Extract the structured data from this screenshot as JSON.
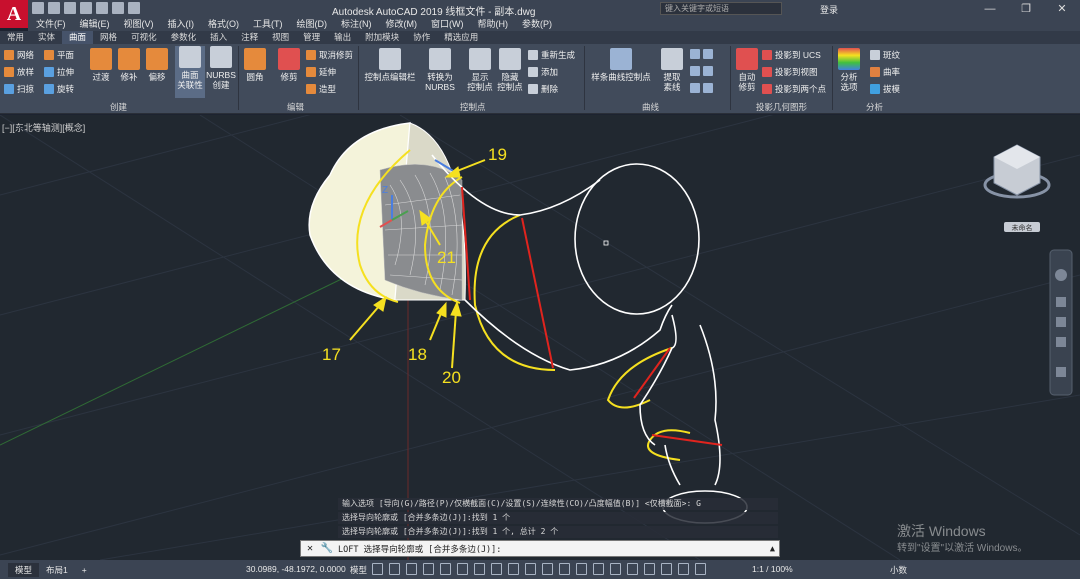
{
  "titlebar": {
    "logo": "A",
    "title": "Autodesk AutoCAD 2019    线框文件 - 副本.dwg",
    "search_placeholder": "键入关键字或短语",
    "login": "登录",
    "minimize": "—",
    "restore": "❐",
    "close": "✕"
  },
  "menu": [
    "文件(F)",
    "编辑(E)",
    "视图(V)",
    "插入(I)",
    "格式(O)",
    "工具(T)",
    "绘图(D)",
    "标注(N)",
    "修改(M)",
    "窗口(W)",
    "帮助(H)",
    "参数(P)"
  ],
  "ribbon_tabs": [
    {
      "label": "常用",
      "active": false
    },
    {
      "label": "实体",
      "active": false
    },
    {
      "label": "曲面",
      "active": true
    },
    {
      "label": "网格",
      "active": false
    },
    {
      "label": "可视化",
      "active": false
    },
    {
      "label": "参数化",
      "active": false
    },
    {
      "label": "插入",
      "active": false
    },
    {
      "label": "注释",
      "active": false
    },
    {
      "label": "视图",
      "active": false
    },
    {
      "label": "管理",
      "active": false
    },
    {
      "label": "输出",
      "active": false
    },
    {
      "label": "附加模块",
      "active": false
    },
    {
      "label": "协作",
      "active": false
    },
    {
      "label": "精选应用",
      "active": false
    }
  ],
  "ribbon": {
    "create_small": [
      "网络",
      "平面",
      "放样",
      "拉伸",
      "扫掠",
      "旋转"
    ],
    "create_big": [
      "过渡",
      "修补",
      "偏移"
    ],
    "associativity": "曲面\n关联性",
    "nurbs_create": "NURBS\n创建",
    "create_label": "创建",
    "fillet": "圆角",
    "trim": "修剪",
    "edit_small": [
      "取消修剪",
      "延伸",
      "造型"
    ],
    "edit_label": "编辑",
    "cv_editbar": "控制点编辑栏",
    "convert_nurbs": "转换为\nNURBS",
    "show_cv": "显示\n控制点",
    "hide_cv": "隐藏\n控制点",
    "cv_small": [
      "重新生成",
      "添加",
      "删除"
    ],
    "cv_label": "控制点",
    "spline_cv": "样条曲线控制点",
    "extract_isoline": "提取\n素线",
    "curve_label": "曲线",
    "auto_trim": "自动\n修剪",
    "proj_small": [
      "投影到 UCS",
      "投影到视图",
      "投影到两个点"
    ],
    "proj_label": "投影几何图形",
    "analysis_options": "分析\n选项",
    "analysis_small": [
      "斑纹",
      "曲率",
      "拔模"
    ],
    "analysis_label": "分析"
  },
  "viewport": {
    "label": "[−][东北等轴测][概念]",
    "viewcube_label": "未命名"
  },
  "annotations": [
    "19",
    "21",
    "17",
    "18",
    "20"
  ],
  "command_history": [
    "输入选项 [导向(G)/路径(P)/仅横截面(C)/设置(S)/连续性(CO)/凸度幅值(B)] <仅横截面>: G",
    "选择导向轮廓或 [合并多条边(J)]:找到 1 个",
    "选择导向轮廓或 [合并多条边(J)]:找到 1 个, 总计 2 个"
  ],
  "command_line": {
    "close": "✕",
    "tool": "🔧",
    "command": "LOFT 选择导向轮廓或 [合并多条边(J)]:",
    "expand": "▲"
  },
  "status": {
    "tab_model": "模型",
    "tab_layout": "布局1",
    "add": "+",
    "coords": "30.0989, -48.1972, 0.0000",
    "model": "模型",
    "scale": "1:1 / 100%",
    "units": "小数"
  },
  "watermark": {
    "line1": "激活 Windows",
    "line2": "转到\"设置\"以激活 Windows。"
  },
  "colors": {
    "accent": "#c8102e",
    "yellow": "#f5e020",
    "red": "#e0241e"
  }
}
